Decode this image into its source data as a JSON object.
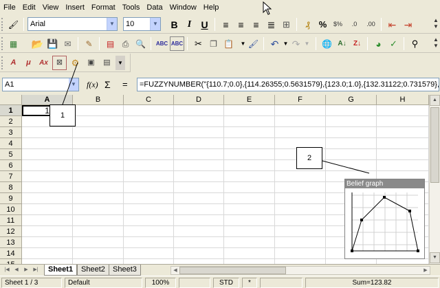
{
  "menu": [
    "File",
    "Edit",
    "View",
    "Insert",
    "Format",
    "Tools",
    "Data",
    "Window",
    "Help"
  ],
  "font": {
    "name": "Arial",
    "size": "10"
  },
  "formula": {
    "cell_ref": "A1",
    "fx_label": "f(x)",
    "sum_symbol": "Σ",
    "equals": "=",
    "content": "=FUZZYNUMBER(\"{110.7;0.0},{114.26355;0.5631579},{123.0;1.0},{132.31122;0.731579},{135"
  },
  "columns": [
    "A",
    "B",
    "C",
    "D",
    "E",
    "F",
    "G",
    "H"
  ],
  "rows": [
    "1",
    "2",
    "3",
    "4",
    "5",
    "6",
    "7",
    "8",
    "9",
    "10",
    "11",
    "12",
    "13",
    "14",
    "15"
  ],
  "cell_A1_value": "123.82",
  "callouts": [
    "1",
    "2"
  ],
  "belief_graph": {
    "title": "Belief graph",
    "points": [
      [
        0,
        0
      ],
      [
        0.6,
        1.0
      ],
      [
        1,
        0
      ],
      [
        0.3,
        0.55
      ],
      [
        0.85,
        0.7
      ]
    ]
  },
  "sheets": [
    "Sheet1",
    "Sheet2",
    "Sheet3"
  ],
  "active_sheet": "Sheet1",
  "status": {
    "sheet": "Sheet 1 / 3",
    "style": "Default",
    "zoom": "100%",
    "mode": "STD",
    "modified": "*",
    "sum": "Sum=123.82"
  },
  "icons": [
    "open-icon",
    "save-icon",
    "email-icon",
    "edit-icon",
    "pdf-icon",
    "print-icon",
    "preview-icon",
    "spellcheck-icon",
    "autospell-icon",
    "cut-icon",
    "copy-icon",
    "paste-icon",
    "brush-icon",
    "undo-icon",
    "redo-icon",
    "hyperlink-icon",
    "sort-asc-icon",
    "sort-desc-icon",
    "chart-icon",
    "check-icon",
    "binoculars-icon"
  ]
}
